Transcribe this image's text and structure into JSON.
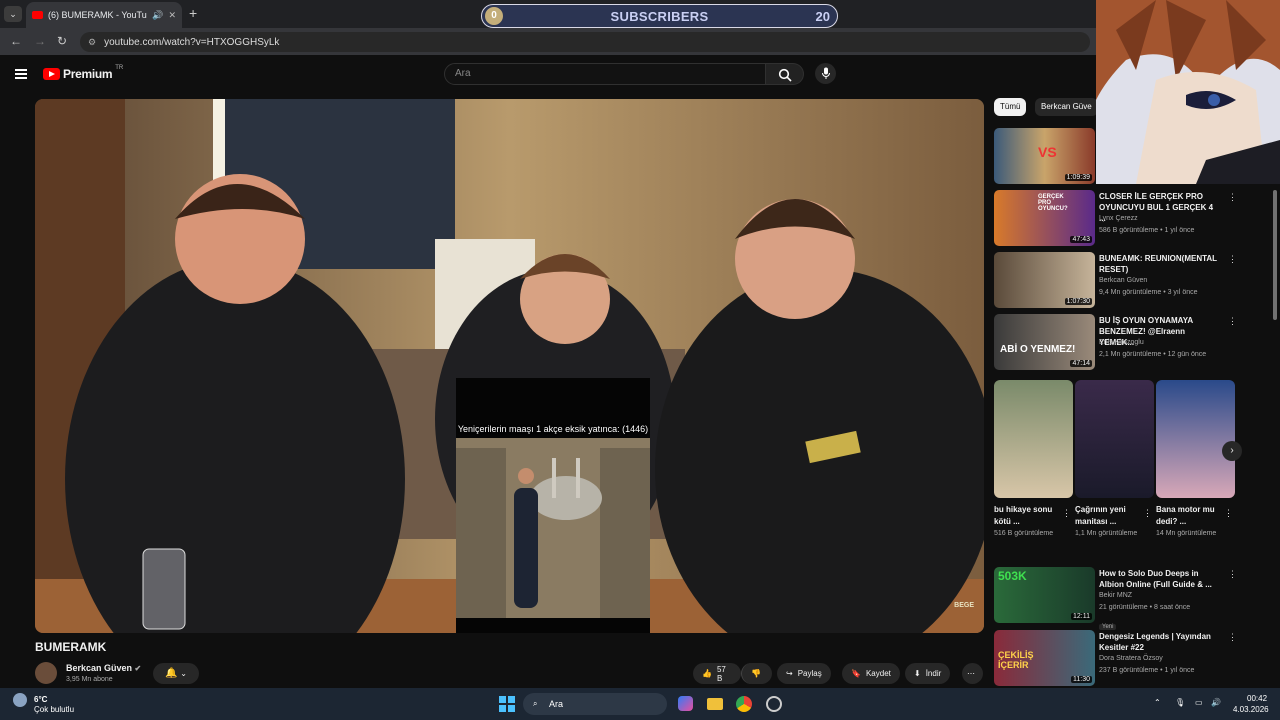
{
  "browser": {
    "tab_title": "(6) BUMERAMK - YouTube",
    "url": "youtube.com/watch?v=HTXOGGHSyLk"
  },
  "overlay": {
    "label": "SUBSCRIBERS",
    "count": "20",
    "badge": "0"
  },
  "youtube": {
    "brand": "Premium",
    "region": "TR",
    "search_placeholder": "Ara"
  },
  "video": {
    "title": "BUMERAMK",
    "channel": "Berkcan Güven",
    "subscribers": "3,95 Mn abone",
    "likes": "57 B",
    "share": "Paylaş",
    "save": "Kaydet",
    "download": "İndir",
    "inset_caption": "Yeniçerilerin maaşı 1 akçe eksik yatınca: (1446)",
    "watermark": "BEGE"
  },
  "chips": [
    "Tümü",
    "Berkcan Güve"
  ],
  "recommendations": [
    {
      "title": "",
      "channel": "",
      "meta": "",
      "duration": "1:09:39",
      "thumb_text": "VS"
    },
    {
      "title": "CLOSER İLE GERÇEK PRO OYUNCUYU BUL 1 GERÇEK 4 ...",
      "channel": "Lynx Çerezz",
      "meta": "586 B görüntüleme • 1 yıl önce",
      "duration": "47:43",
      "thumb_text": "GERÇEK PRO OYUNCU?"
    },
    {
      "title": "BUNEAMK: REUNION(MENTAL RESET)",
      "channel": "Berkcan Güven",
      "meta": "9,4 Mn görüntüleme • 3 yıl önce",
      "duration": "1:07:30",
      "thumb_text": ""
    },
    {
      "title": "BU İŞ OYUN OYNAMAYA BENZEMEZ! @Elraenn YEMEK...",
      "channel": "Enis Kirazoglu",
      "meta": "2,1 Mn görüntüleme • 12 gün önce",
      "duration": "47:14",
      "thumb_text": "ABİ O YENMEZ!"
    },
    {
      "title": "How to Solo Duo Deeps in Albion Online (Full Guide & ...",
      "channel": "Bekir MNZ",
      "meta": "21 görüntüleme • 8 saat önce",
      "duration": "12:11",
      "badge": "Yeni",
      "thumb_text": "503K"
    },
    {
      "title": "Dengesiz Legends | Yayından Kesitler #22",
      "channel": "Dora Stratera Özsoy",
      "meta": "237 B görüntüleme • 1 yıl önce",
      "duration": "11:30",
      "thumb_text": "ÇEKİLİŞ İÇERİR"
    }
  ],
  "shorts": [
    {
      "title": "bu hikaye sonu kötü ...",
      "views": "516 B görüntüleme"
    },
    {
      "title": "Çağrının yeni manitası ...",
      "views": "1,1 Mn görüntüleme"
    },
    {
      "title": "Bana motor mu dedi? ...",
      "views": "14 Mn görüntüleme"
    }
  ],
  "taskbar": {
    "temp": "6°C",
    "weather": "Çok bulutlu",
    "search": "Ara",
    "time": "00:42",
    "date": "4.03.2026"
  }
}
